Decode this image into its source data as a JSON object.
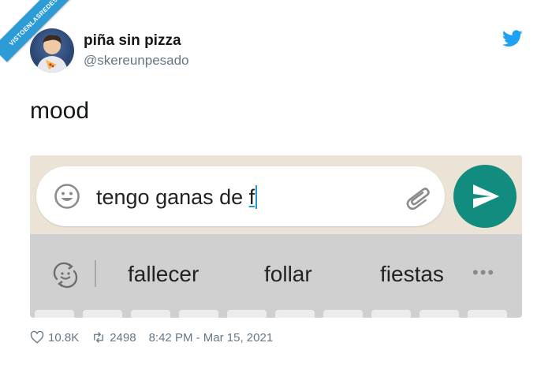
{
  "watermark": {
    "text": "VISTOENLASREDES"
  },
  "tweet": {
    "display_name": "piña sin pizza",
    "handle": "@skereunpesado",
    "text": "mood",
    "likes": "10.8K",
    "retweets": "2498",
    "timestamp": "8:42 PM - Mar 15, 2021"
  },
  "media": {
    "input_value_prefix": "tengo ganas de ",
    "input_value_last": "f",
    "suggestions": [
      "fallecer",
      "follar",
      "fiestas"
    ]
  },
  "colors": {
    "twitter_blue": "#1da1f2",
    "whatsapp_green": "#128c7e",
    "caret": "#1f9bd1"
  },
  "icons": [
    "twitter-bird-icon",
    "emoji-icon",
    "paperclip-icon",
    "send-icon",
    "emoji-refresh-icon",
    "more-dots-icon",
    "heart-icon",
    "retweet-icon"
  ]
}
